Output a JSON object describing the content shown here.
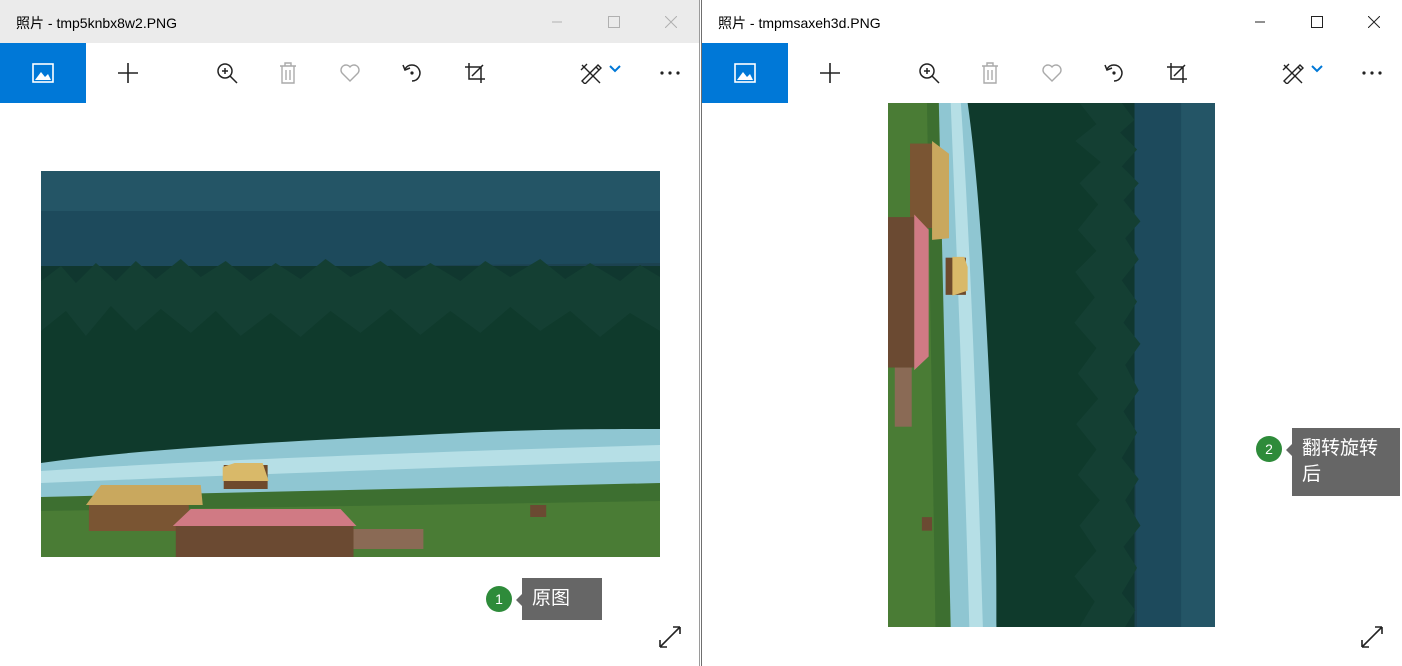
{
  "windows": [
    {
      "title": "照片 - tmp5knbx8w2.PNG",
      "toolbar": [
        "photo-icon",
        "add-icon",
        "zoom-icon",
        "delete-icon",
        "favorite-icon",
        "rotate-icon",
        "crop-icon",
        "edit-icon",
        "more-icon"
      ],
      "callout": {
        "number": "1",
        "label": "原图"
      }
    },
    {
      "title": "照片 - tmpmsaxeh3d.PNG",
      "toolbar": [
        "photo-icon",
        "add-icon",
        "zoom-icon",
        "delete-icon",
        "favorite-icon",
        "rotate-icon",
        "crop-icon",
        "edit-icon",
        "more-icon"
      ],
      "callout": {
        "number": "2",
        "label": "翻转旋转后"
      }
    }
  ],
  "colors": {
    "accent": "#0078d7",
    "badge": "#2e8b3a",
    "callout_bg": "#666666"
  }
}
